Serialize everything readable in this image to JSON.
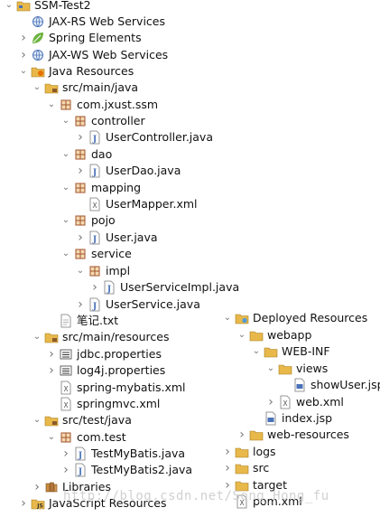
{
  "left_tree": [
    {
      "label": "SSM-Test2",
      "expanded": true,
      "icon": "project-icon"
    },
    {
      "label": "JAX-RS Web Services",
      "expanded": null,
      "icon": "web-services-icon"
    },
    {
      "label": "Spring Elements",
      "expanded": false,
      "icon": "spring-leaf-icon"
    },
    {
      "label": "JAX-WS Web Services",
      "expanded": false,
      "icon": "web-services-icon"
    },
    {
      "label": "Java Resources",
      "expanded": true,
      "icon": "java-resources-icon"
    },
    {
      "label": "src/main/java",
      "expanded": true,
      "icon": "source-folder-icon"
    },
    {
      "label": "com.jxust.ssm",
      "expanded": true,
      "icon": "package-icon"
    },
    {
      "label": "controller",
      "expanded": true,
      "icon": "package-icon"
    },
    {
      "label": "UserController.java",
      "expanded": false,
      "icon": "java-file-icon"
    },
    {
      "label": "dao",
      "expanded": true,
      "icon": "package-icon"
    },
    {
      "label": "UserDao.java",
      "expanded": false,
      "icon": "java-file-icon"
    },
    {
      "label": "mapping",
      "expanded": true,
      "icon": "package-icon"
    },
    {
      "label": "UserMapper.xml",
      "expanded": null,
      "icon": "xml-file-icon"
    },
    {
      "label": "pojo",
      "expanded": true,
      "icon": "package-icon"
    },
    {
      "label": "User.java",
      "expanded": false,
      "icon": "java-file-icon"
    },
    {
      "label": "service",
      "expanded": true,
      "icon": "package-icon"
    },
    {
      "label": "impl",
      "expanded": true,
      "icon": "package-icon"
    },
    {
      "label": "UserServiceImpl.java",
      "expanded": false,
      "icon": "java-file-icon"
    },
    {
      "label": "UserService.java",
      "expanded": false,
      "icon": "java-file-icon"
    },
    {
      "label": "笔记.txt",
      "expanded": null,
      "icon": "text-file-icon"
    },
    {
      "label": "src/main/resources",
      "expanded": true,
      "icon": "source-folder-icon"
    },
    {
      "label": "jdbc.properties",
      "expanded": false,
      "icon": "properties-file-icon"
    },
    {
      "label": "log4j.properties",
      "expanded": false,
      "icon": "properties-file-icon"
    },
    {
      "label": "spring-mybatis.xml",
      "expanded": null,
      "icon": "xml-file-icon"
    },
    {
      "label": "springmvc.xml",
      "expanded": null,
      "icon": "xml-file-icon"
    },
    {
      "label": "src/test/java",
      "expanded": true,
      "icon": "source-folder-icon"
    },
    {
      "label": "com.test",
      "expanded": true,
      "icon": "package-icon"
    },
    {
      "label": "TestMyBatis.java",
      "expanded": false,
      "icon": "java-file-icon"
    },
    {
      "label": "TestMyBatis2.java",
      "expanded": false,
      "icon": "java-file-icon"
    },
    {
      "label": "Libraries",
      "expanded": false,
      "icon": "library-icon"
    },
    {
      "label": "JavaScript Resources",
      "expanded": false,
      "icon": "javascript-resources-icon"
    }
  ],
  "right_tree": [
    {
      "label": "Deployed Resources",
      "expanded": true,
      "icon": "deployed-resources-icon"
    },
    {
      "label": "webapp",
      "expanded": true,
      "icon": "folder-icon"
    },
    {
      "label": "WEB-INF",
      "expanded": true,
      "icon": "folder-icon"
    },
    {
      "label": "views",
      "expanded": true,
      "icon": "folder-icon"
    },
    {
      "label": "showUser.jsp",
      "expanded": null,
      "icon": "jsp-file-icon"
    },
    {
      "label": "web.xml",
      "expanded": false,
      "icon": "xml-file-icon"
    },
    {
      "label": "index.jsp",
      "expanded": null,
      "icon": "jsp-file-icon"
    },
    {
      "label": "web-resources",
      "expanded": false,
      "icon": "folder-icon"
    },
    {
      "label": "logs",
      "expanded": false,
      "icon": "folder-icon"
    },
    {
      "label": "src",
      "expanded": false,
      "icon": "folder-icon"
    },
    {
      "label": "target",
      "expanded": false,
      "icon": "folder-icon"
    },
    {
      "label": "pom.xml",
      "expanded": null,
      "icon": "xml-file-icon"
    }
  ],
  "watermark": "http://blog.csdn.net/Song_Hong_fu",
  "colors": {
    "folder": "#e8b84a",
    "package": "#a0522d",
    "java": "#4a72b8",
    "spring": "#6db33f",
    "chevron": "#777777"
  }
}
